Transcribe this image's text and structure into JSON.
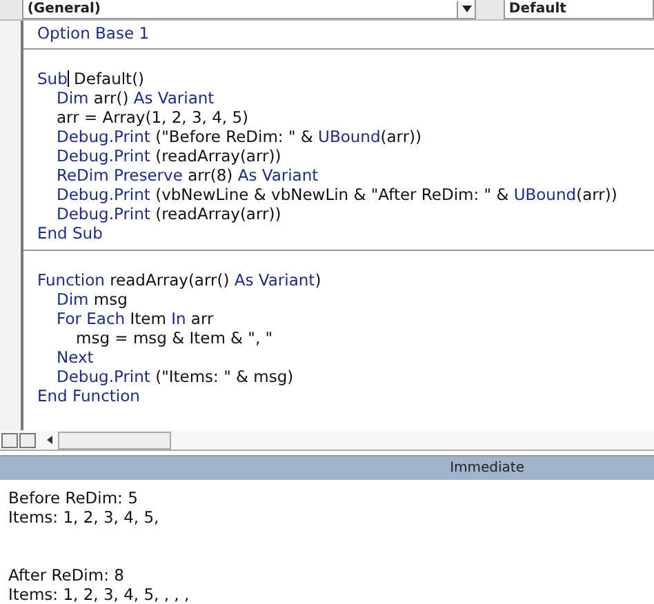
{
  "toolbar": {
    "object_combo": "(General)",
    "procedure_combo": "Default"
  },
  "code": {
    "declarations": [
      [
        {
          "text": "Option Base 1",
          "kind": "keyword"
        }
      ]
    ],
    "procedures": [
      {
        "header": [
          {
            "text": "Sub",
            "kind": "keyword"
          },
          {
            "text": " Default()",
            "kind": "plain",
            "caret_before": true
          }
        ],
        "body": [
          {
            "tokens": [
              {
                "text": "Dim",
                "kind": "keyword"
              },
              {
                "text": " arr() ",
                "kind": "plain"
              },
              {
                "text": "As Variant",
                "kind": "keyword"
              }
            ]
          },
          {
            "tokens": [
              {
                "text": "arr = Array(1, 2, 3, 4, 5)",
                "kind": "plain"
              }
            ]
          },
          {
            "tokens": [
              {
                "text": "Debug.Print",
                "kind": "keyword"
              },
              {
                "text": " (\"Before ReDim: \" & ",
                "kind": "plain"
              },
              {
                "text": "UBound",
                "kind": "keyword"
              },
              {
                "text": "(arr))",
                "kind": "plain"
              }
            ]
          },
          {
            "tokens": [
              {
                "text": "Debug.Print",
                "kind": "keyword"
              },
              {
                "text": " (readArray(arr))",
                "kind": "plain"
              }
            ]
          },
          {
            "tokens": [
              {
                "text": "ReDim Preserve",
                "kind": "keyword"
              },
              {
                "text": " arr(8) ",
                "kind": "plain"
              },
              {
                "text": "As Variant",
                "kind": "keyword"
              }
            ]
          },
          {
            "tokens": [
              {
                "text": "Debug.Print",
                "kind": "keyword"
              },
              {
                "text": " (vbNewLine & vbNewLin & \"After ReDim: \" & ",
                "kind": "plain"
              },
              {
                "text": "UBound",
                "kind": "keyword"
              },
              {
                "text": "(arr))",
                "kind": "plain"
              }
            ]
          },
          {
            "tokens": [
              {
                "text": "Debug.Print",
                "kind": "keyword"
              },
              {
                "text": " (readArray(arr))",
                "kind": "plain"
              }
            ]
          }
        ],
        "footer": [
          {
            "text": "End Sub",
            "kind": "keyword"
          }
        ]
      },
      {
        "header": [
          {
            "text": "Function",
            "kind": "keyword"
          },
          {
            "text": " readArray(arr() ",
            "kind": "plain"
          },
          {
            "text": "As Variant",
            "kind": "keyword"
          },
          {
            "text": ")",
            "kind": "plain"
          }
        ],
        "body": [
          {
            "tokens": [
              {
                "text": "Dim",
                "kind": "keyword"
              },
              {
                "text": " msg",
                "kind": "plain"
              }
            ]
          },
          {
            "tokens": [
              {
                "text": "For Each",
                "kind": "keyword"
              },
              {
                "text": " Item ",
                "kind": "plain"
              },
              {
                "text": "In",
                "kind": "keyword"
              },
              {
                "text": " arr",
                "kind": "plain"
              }
            ],
            "children": [
              {
                "tokens": [
                  {
                    "text": "msg = msg & Item & \", \"",
                    "kind": "plain"
                  }
                ]
              }
            ]
          },
          {
            "tokens": [
              {
                "text": "Next",
                "kind": "keyword"
              }
            ]
          },
          {
            "tokens": [
              {
                "text": "Debug.Print",
                "kind": "keyword"
              },
              {
                "text": " (\"Items: \" & msg)",
                "kind": "plain"
              }
            ]
          }
        ],
        "footer": [
          {
            "text": "End Function",
            "kind": "keyword"
          }
        ]
      }
    ]
  },
  "immediate": {
    "title": "Immediate",
    "groups": [
      {
        "lines": [
          "Before ReDim: 5",
          "Items: 1, 2, 3, 4, 5,"
        ]
      },
      {
        "lines": [
          "After ReDim: 8",
          "Items: 1, 2, 3, 4, 5, , , ,"
        ]
      }
    ]
  }
}
